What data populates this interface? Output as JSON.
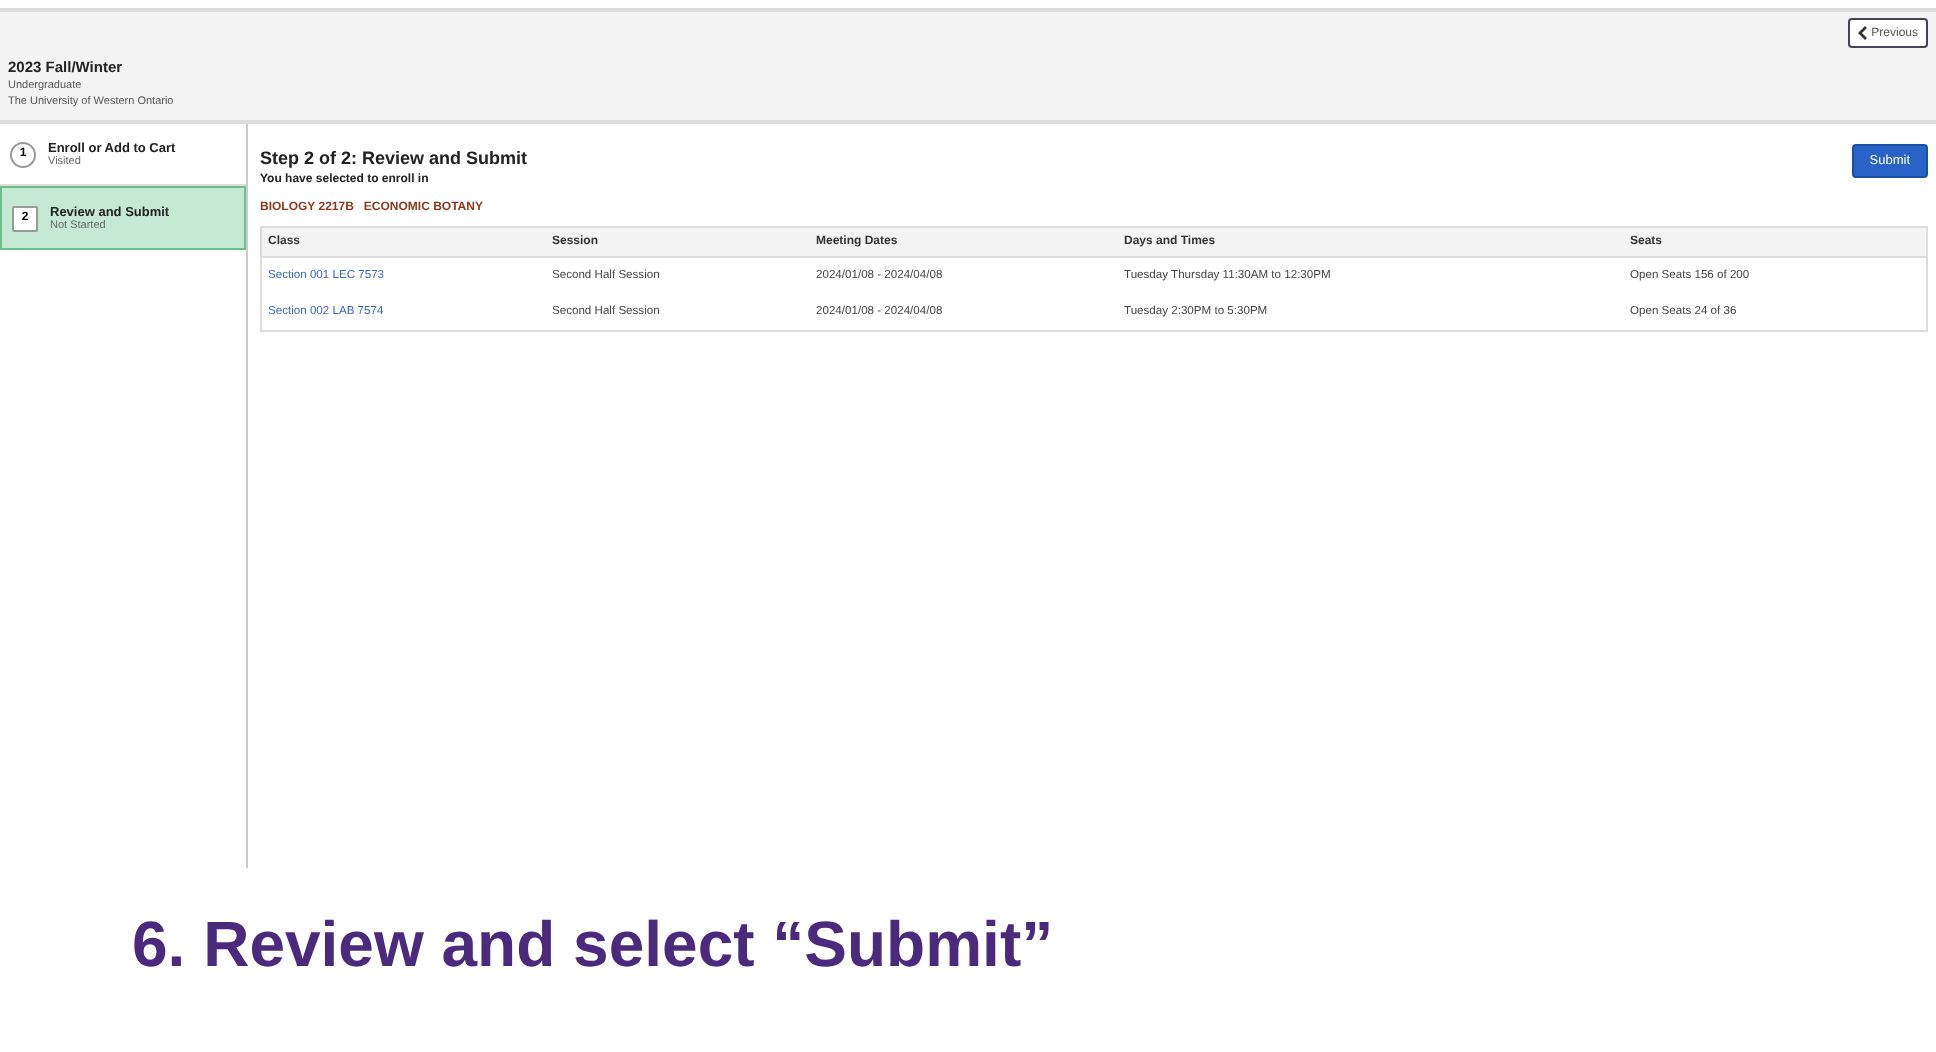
{
  "header": {
    "term": "2023 Fall/Winter",
    "career": "Undergraduate",
    "institution": "The University of Western Ontario",
    "previous_button": "Previous"
  },
  "steps": [
    {
      "number": "1",
      "title": "Enroll or Add to Cart",
      "status": "Visited",
      "selected": false
    },
    {
      "number": "2",
      "title": "Review and Submit",
      "status": "Not Started",
      "selected": true
    }
  ],
  "main": {
    "title": "Step 2 of 2: Review and Submit",
    "subtitle": "You have selected to enroll in",
    "course_code": "BIOLOGY 2217B",
    "course_name": "ECONOMIC BOTANY",
    "submit_button": "Submit"
  },
  "table": {
    "columns": [
      "Class",
      "Session",
      "Meeting Dates",
      "Days and Times",
      "Seats"
    ],
    "rows": [
      [
        "Section 001 LEC 7573",
        "Second Half Session",
        "2024/01/08 - 2024/04/08",
        "Tuesday Thursday   11:30AM to 12:30PM",
        "Open Seats 156 of 200"
      ],
      [
        "Section 002 LAB 7574",
        "Second Half Session",
        "2024/01/08 - 2024/04/08",
        "Tuesday   2:30PM to 5:30PM",
        "Open Seats 24 of 36"
      ]
    ]
  },
  "caption": "6. Review and select “Submit”"
}
